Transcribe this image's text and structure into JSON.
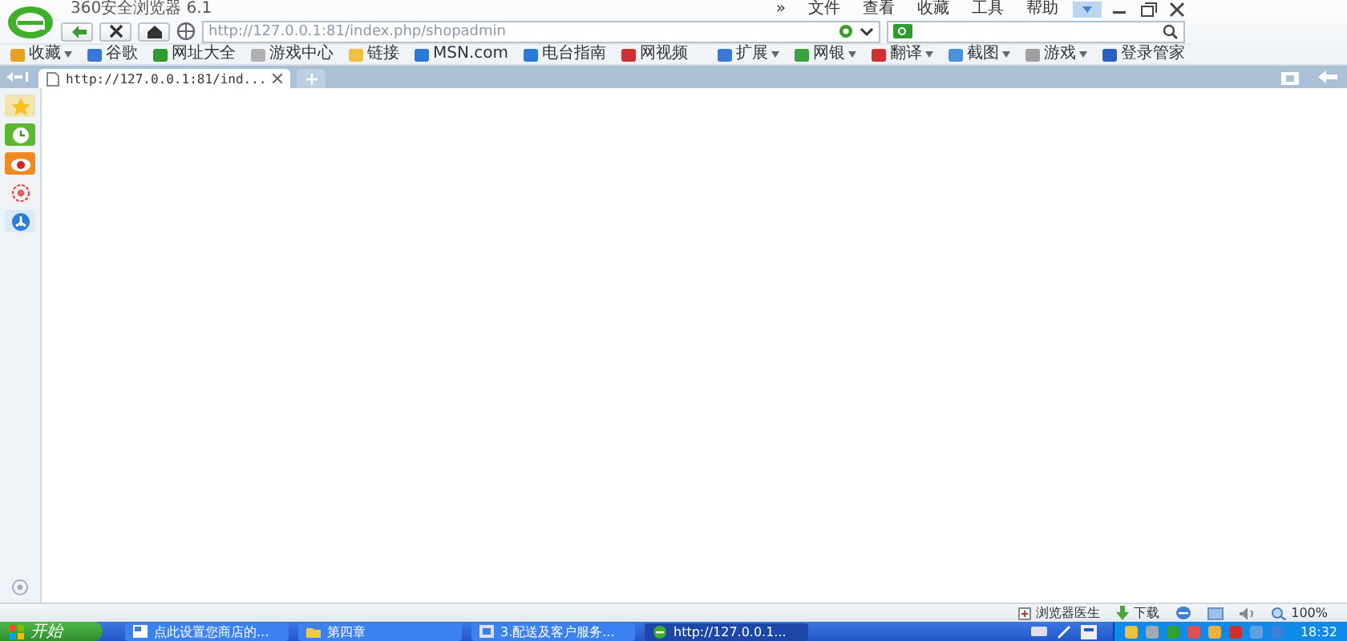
{
  "window": {
    "title": "360安全浏览器 6.1"
  },
  "menu": [
    {
      "label": "»"
    },
    {
      "label": "文件"
    },
    {
      "label": "查看"
    },
    {
      "label": "收藏"
    },
    {
      "label": "工具"
    },
    {
      "label": "帮助"
    }
  ],
  "address": {
    "value": "http://127.0.0.1:81/index.php/shopadmin"
  },
  "bookmarks": [
    {
      "label": "收藏",
      "color": "#e8a020",
      "dropdown": true
    },
    {
      "label": "谷歌",
      "color": "#3a78d8",
      "dropdown": false
    },
    {
      "label": "网址大全",
      "color": "#2f9a2f",
      "dropdown": false
    },
    {
      "label": "游戏中心",
      "color": "#b0b0b0",
      "dropdown": false
    },
    {
      "label": "链接",
      "color": "#f0c040",
      "dropdown": false
    },
    {
      "label": "MSN.com",
      "color": "#2a7ad8",
      "dropdown": false
    },
    {
      "label": "电台指南",
      "color": "#2a7ad8",
      "dropdown": false
    },
    {
      "label": "网视频",
      "color": "#d03030",
      "dropdown": false
    }
  ],
  "tools": [
    {
      "label": "扩展",
      "color": "#3a78d8",
      "dropdown": true
    },
    {
      "label": "网银",
      "color": "#3aa040",
      "dropdown": true
    },
    {
      "label": "翻译",
      "color": "#d03030",
      "dropdown": true
    },
    {
      "label": "截图",
      "color": "#4a90d8",
      "dropdown": true
    },
    {
      "label": "游戏",
      "color": "#a0a0a0",
      "dropdown": true
    },
    {
      "label": "登录管家",
      "color": "#2a60c0",
      "dropdown": false
    }
  ],
  "tabs": [
    {
      "label": "http://127.0.0.1:81/ind...",
      "selected": true
    }
  ],
  "status_bar": {
    "doctor": "浏览器医生",
    "download": "下载",
    "zoom": "100%"
  },
  "taskbar": {
    "start": "开始",
    "tasks": [
      {
        "label": "点此设置您商店的...",
        "selected": false
      },
      {
        "label": "第四章",
        "selected": false
      },
      {
        "label": "3.配送及客户服务...",
        "selected": false
      },
      {
        "label": "http://127.0.0.1...",
        "selected": true
      }
    ],
    "clock": "18:32"
  }
}
